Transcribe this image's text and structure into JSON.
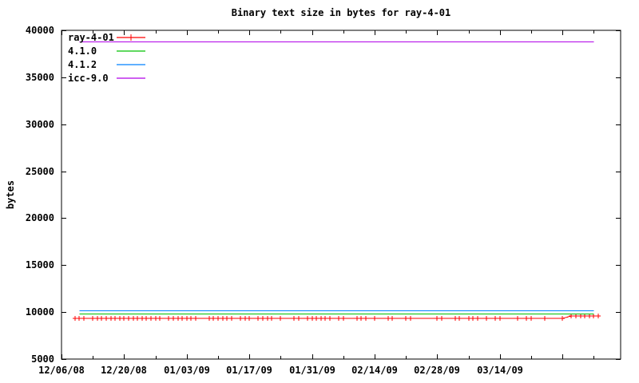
{
  "chart_data": {
    "type": "line",
    "title": "Binary text size in bytes for ray-4-01",
    "xlabel": "",
    "ylabel": "bytes",
    "x_unit": "days since 12/06/08",
    "xlim": [
      0,
      125
    ],
    "ylim": [
      5000,
      40000
    ],
    "grid": false,
    "legend_position": "top-left",
    "background": "#ffffff",
    "axis_color": "#000000",
    "yticks": [
      5000,
      10000,
      15000,
      20000,
      25000,
      30000,
      35000,
      40000
    ],
    "xticks": [
      {
        "day": 0,
        "label": "12/06/08"
      },
      {
        "day": 14,
        "label": "12/20/08"
      },
      {
        "day": 28,
        "label": "01/03/09"
      },
      {
        "day": 42,
        "label": "01/17/09"
      },
      {
        "day": 56,
        "label": "01/31/09"
      },
      {
        "day": 70,
        "label": "02/14/09"
      },
      {
        "day": 84,
        "label": "02/28/09"
      },
      {
        "day": 98,
        "label": "03/14/09"
      }
    ],
    "xticks_unlabeled_major_days": [
      112
    ],
    "xticks_minor_days": [
      7,
      21,
      35,
      49,
      63,
      77,
      91,
      105,
      119
    ],
    "series": [
      {
        "name": "ray-4-01",
        "color": "#ff0000",
        "style": "linespoints",
        "marker": "plus",
        "points": [
          [
            3,
            9330
          ],
          [
            4,
            9330
          ],
          [
            5,
            9330
          ],
          [
            7,
            9330
          ],
          [
            8,
            9330
          ],
          [
            9,
            9330
          ],
          [
            10,
            9330
          ],
          [
            11,
            9330
          ],
          [
            12,
            9330
          ],
          [
            13,
            9330
          ],
          [
            14,
            9330
          ],
          [
            15,
            9330
          ],
          [
            16,
            9330
          ],
          [
            17,
            9330
          ],
          [
            18,
            9330
          ],
          [
            19,
            9330
          ],
          [
            20,
            9330
          ],
          [
            21,
            9330
          ],
          [
            22,
            9330
          ],
          [
            24,
            9330
          ],
          [
            25,
            9330
          ],
          [
            26,
            9330
          ],
          [
            27,
            9330
          ],
          [
            28,
            9330
          ],
          [
            29,
            9330
          ],
          [
            30,
            9330
          ],
          [
            33,
            9330
          ],
          [
            34,
            9330
          ],
          [
            35,
            9330
          ],
          [
            36,
            9330
          ],
          [
            37,
            9330
          ],
          [
            38,
            9330
          ],
          [
            40,
            9330
          ],
          [
            41,
            9330
          ],
          [
            42,
            9330
          ],
          [
            44,
            9330
          ],
          [
            45,
            9330
          ],
          [
            46,
            9330
          ],
          [
            47,
            9330
          ],
          [
            49,
            9330
          ],
          [
            52,
            9330
          ],
          [
            53,
            9330
          ],
          [
            55,
            9330
          ],
          [
            56,
            9330
          ],
          [
            57,
            9330
          ],
          [
            58,
            9330
          ],
          [
            59,
            9330
          ],
          [
            60,
            9330
          ],
          [
            62,
            9330
          ],
          [
            63,
            9330
          ],
          [
            66,
            9330
          ],
          [
            67,
            9330
          ],
          [
            68,
            9330
          ],
          [
            70,
            9330
          ],
          [
            73,
            9330
          ],
          [
            74,
            9330
          ],
          [
            77,
            9330
          ],
          [
            78,
            9330
          ],
          [
            84,
            9330
          ],
          [
            85,
            9330
          ],
          [
            88,
            9330
          ],
          [
            89,
            9330
          ],
          [
            91,
            9330
          ],
          [
            92,
            9330
          ],
          [
            93,
            9330
          ],
          [
            95,
            9330
          ],
          [
            97,
            9330
          ],
          [
            98,
            9330
          ],
          [
            102,
            9330
          ],
          [
            104,
            9330
          ],
          [
            105,
            9330
          ],
          [
            108,
            9330
          ],
          [
            112,
            9330
          ],
          [
            114,
            9590
          ],
          [
            115,
            9590
          ],
          [
            116,
            9590
          ],
          [
            117,
            9590
          ],
          [
            118,
            9590
          ],
          [
            119,
            9590
          ],
          [
            120,
            9590
          ]
        ]
      },
      {
        "name": "4.1.0",
        "color": "#00c000",
        "style": "line",
        "marker": "none",
        "value_bytes": 9870,
        "day_range": [
          4,
          119
        ]
      },
      {
        "name": "4.1.2",
        "color": "#0080ff",
        "style": "line",
        "marker": "none",
        "value_bytes": 10200,
        "day_range": [
          4,
          119
        ]
      },
      {
        "name": "icc-9.0",
        "color": "#b000e8",
        "style": "line",
        "marker": "none",
        "value_bytes": 38800,
        "day_range": [
          4,
          119
        ]
      }
    ]
  }
}
